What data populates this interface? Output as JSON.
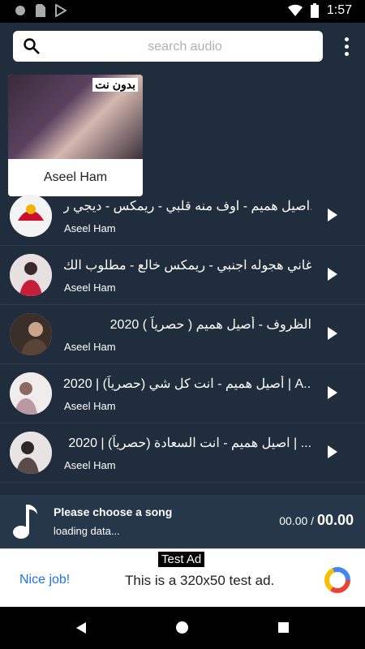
{
  "status": {
    "time": "1:57"
  },
  "search": {
    "placeholder": "search audio"
  },
  "featured": {
    "title": "Aseel Ham",
    "tag": "بدون نت"
  },
  "tracks": [
    {
      "title": "اصيل هميم - اوف منه قلبي - ريمكس - ديجي ر...",
      "artist": "Aseel Ham"
    },
    {
      "title": "اغاني هجوله اجنبي - ريمكس خالع - مطلوب الك...",
      "artist": "Aseel Ham"
    },
    {
      "title": "الظروف - أصيل هميم ( حصرياً ) 2020",
      "artist": "Aseel Ham"
    },
    {
      "title": "أصيل هميم - انت كل شي (حصرياً) | 2020 | A...",
      "artist": "Aseel Ham"
    },
    {
      "title": "اصيل هميم - انت السعادة  (حصرياً) | 2020 | ...",
      "artist": "Aseel Ham"
    }
  ],
  "player": {
    "song": "Please choose a song",
    "status": "loading data...",
    "current": "00.00",
    "separator": "/",
    "total": "00.00"
  },
  "ad": {
    "label": "Test Ad",
    "cta": "Nice job!",
    "text": "This is a 320x50 test ad."
  }
}
